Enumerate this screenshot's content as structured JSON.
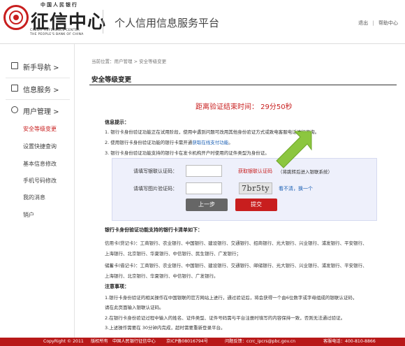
{
  "header": {
    "logo_top": "中国人民银行",
    "logo_main": "征信中心",
    "logo_en_line1": "CREDIT REFERENCE CENTER",
    "logo_en_line2": "THE PEOPLE'S BANK OF CHINA",
    "platform_title": "个人信用信息服务平台",
    "link_logout": "退出",
    "link_separator": "|",
    "link_help": "帮助中心"
  },
  "sidebar": {
    "nav": [
      {
        "label": "新手导航 >",
        "icon": "book-icon"
      },
      {
        "label": "信息服务 >",
        "icon": "document-icon"
      },
      {
        "label": "用户管理 >",
        "icon": "user-icon"
      }
    ],
    "sub_items": [
      {
        "label": "安全等级变更",
        "active": true
      },
      {
        "label": "设置快捷查询",
        "active": false
      },
      {
        "label": "基本信息修改",
        "active": false
      },
      {
        "label": "手机号码修改",
        "active": false
      },
      {
        "label": "我的消息",
        "active": false
      },
      {
        "label": "销户",
        "active": false
      }
    ]
  },
  "main": {
    "breadcrumb": "当前位置：用户管理 > 安全等级变更",
    "title": "安全等级变更",
    "countdown": "距离验证结束时间：  29分50秒",
    "tips_head": "信息提示：",
    "tip1": "1. 银行卡身份验证功能正在试用阶段，使用中遇到问题可改用其他身份验证方式或致电客服电话进行咨询。",
    "tip2_prefix": "2. 使用银行卡身份验证功能的银行卡需开通",
    "tip2_link": "获取在线支付功能",
    "tip2_suffix": "。",
    "tip3": "3. 银行卡身份验证功能支持的银行卡在发卡机构开户时使用的证件类型为身份证。",
    "form": {
      "unionpay_label": "请填写银联认证码：",
      "unionpay_link": "获取银联认证码",
      "unionpay_note": "（将跳转后进入银联系统）",
      "captcha_label": "请填写图片验证码：",
      "captcha_text": "7br5ty",
      "captcha_refresh": "看不清，换一个",
      "btn_prev": "上一步",
      "btn_submit": "提交"
    },
    "bank_head": "银行卡身份验证功能支持的银行卡清单如下：",
    "credit_line1": "信用卡(贷记卡)：工商银行、农业银行、中国银行、建设银行、交通银行、招商银行、光大银行、兴业银行、浦发银行、平安银行、",
    "credit_line2": "上海银行、北京银行、华夏银行、中信银行、民生银行、广发银行；",
    "debit_line1": "储蓄卡(借记卡)：工商银行、农业银行、中国银行、建设银行、交通银行、邮储银行、光大银行、兴业银行、浦发银行、平安银行、",
    "debit_line2": "上海银行、北京银行、华夏银行、中信银行、广发银行。",
    "note_head": "注意事项：",
    "note1": "1.银行卡身份验证的相关操作在中国银联的官方网站上进行，通过验证后，将会获得一个由6位数字或字母组成的银联认证码，",
    "note1b": "请在此页面输入银联认证码。",
    "note2": "2.在银行卡身份验证过程中输入的姓名、证件类型、证件号码需与平台注册时填写的内容保持一致，否则无法通过验证。",
    "note3": "3.上述操作需要在 30分钟内完成，超时需要重新登录平台。"
  },
  "footer": {
    "copyright": "CopyRight © 2011",
    "rights": "版权所有",
    "owner": "中国人民银行征信中心",
    "icp": "京ICP备08016794号",
    "feedback": "问题反馈：ccrc_ipcrs@pbc.gov.cn",
    "hotline": "客服电话：400-810-8866"
  },
  "colors": {
    "brand_red": "#c81e1e",
    "link_blue": "#1a5fb4",
    "form_bg": "#eef0fb",
    "arrow_green": "#8cc63f"
  }
}
